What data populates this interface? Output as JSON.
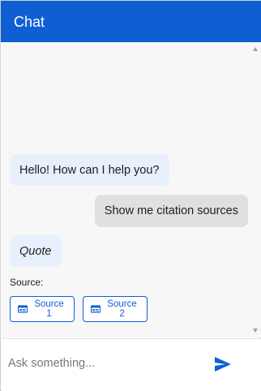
{
  "header": {
    "title": "Chat"
  },
  "messages": [
    {
      "role": "bot",
      "text": "Hello! How can I help you?"
    },
    {
      "role": "user",
      "text": "Show me citation sources"
    },
    {
      "role": "bot",
      "text": "Quote"
    }
  ],
  "sources": {
    "label": "Source:",
    "buttons": [
      {
        "label": "Source 1",
        "icon": "document-card-icon"
      },
      {
        "label": "Source 2",
        "icon": "document-card-icon"
      }
    ]
  },
  "input": {
    "placeholder": "Ask something...",
    "value": ""
  },
  "send": {
    "icon": "send-icon"
  },
  "colors": {
    "accent": "#0f5fd4",
    "bot_bubble": "#e8f0fe",
    "user_bubble": "#e0e0e0",
    "background": "#f7f7f8"
  }
}
